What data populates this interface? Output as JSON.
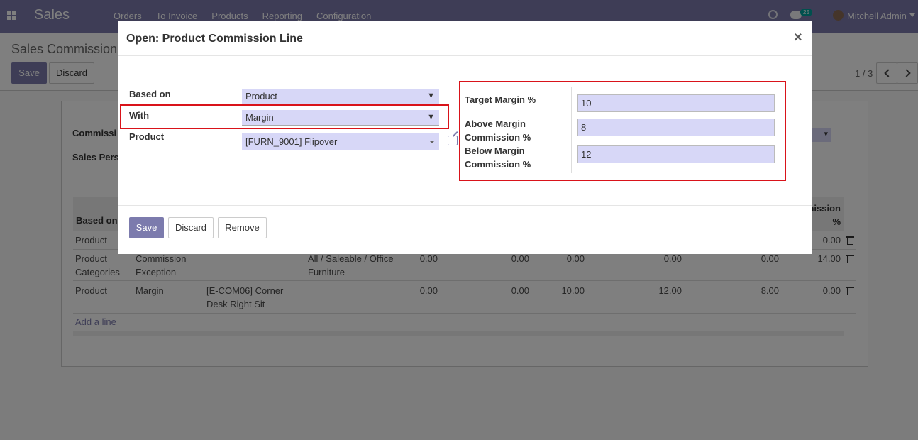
{
  "navbar": {
    "brand": "Sales",
    "menu": [
      "Orders",
      "To Invoice",
      "Products",
      "Reporting",
      "Configuration"
    ],
    "chat_badge": "25",
    "user": "Mitchell Admin"
  },
  "control_panel": {
    "breadcrumb": "Sales Commission",
    "save_label": "Save",
    "discard_label": "Discard",
    "pager": "1 / 3"
  },
  "background_form": {
    "label_commission": "Commissi",
    "label_sales_person": "Sales Pers",
    "table": {
      "header_based_on": "Based on",
      "header_commission_line1": "mission",
      "header_commission_line2": "%",
      "rows": [
        {
          "based_on": "Product",
          "with": "",
          "product": "",
          "category": "",
          "c1": "",
          "c2": "",
          "c3": "",
          "c4": "",
          "c5": "",
          "c6": "0.00"
        },
        {
          "based_on": "Product Categories",
          "with": "Commission Exception",
          "product": "",
          "category": "All / Saleable / Office Furniture",
          "c1": "0.00",
          "c2": "0.00",
          "c3": "0.00",
          "c4": "0.00",
          "c5": "0.00",
          "c6": "14.00"
        },
        {
          "based_on": "Product",
          "with": "Margin",
          "product": "[E-COM06] Corner Desk Right Sit",
          "category": "",
          "c1": "0.00",
          "c2": "0.00",
          "c3": "10.00",
          "c4": "12.00",
          "c5": "8.00",
          "c6": "0.00"
        }
      ],
      "add_line": "Add a line"
    }
  },
  "modal": {
    "title": "Open: Product Commission Line",
    "close": "×",
    "based_on_label": "Based on",
    "based_on_value": "Product",
    "with_label": "With",
    "with_value": "Margin",
    "product_label": "Product",
    "product_value": "[FURN_9001] Flipover",
    "target_margin_label": "Target Margin %",
    "target_margin_value": "10",
    "above_margin_label": "Above Margin Commission %",
    "above_margin_value": "8",
    "below_margin_label": "Below Margin Commission %",
    "below_margin_value": "12",
    "save_label": "Save",
    "discard_label": "Discard",
    "remove_label": "Remove"
  },
  "colors": {
    "brand": "#7c7bad",
    "field_bg": "#d7d7f7",
    "highlight": "#d9131a"
  }
}
